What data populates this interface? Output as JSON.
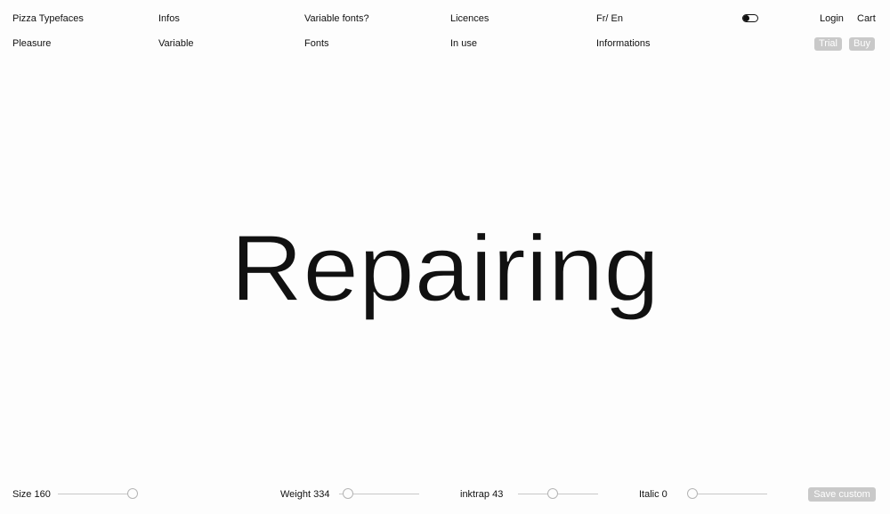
{
  "nav": {
    "row1": [
      "Pizza Typefaces",
      "Infos",
      "Variable fonts?",
      "Licences",
      "Fr/ En"
    ],
    "row2": [
      "Pleasure",
      "Variable",
      "Fonts",
      "In use",
      "Informations"
    ],
    "login": "Login",
    "cart": "Cart",
    "trial": "Trial",
    "buy": "Buy"
  },
  "specimen": {
    "text": "Repairing"
  },
  "controls": {
    "size": {
      "label": "Size 160",
      "value": 160
    },
    "weight": {
      "label": "Weight 334",
      "value": 334
    },
    "inktrap": {
      "label": "inktrap 43",
      "value": 43
    },
    "italic": {
      "label": "Italic 0",
      "value": 0
    },
    "save_label": "Save custom"
  },
  "colors": {
    "text": "#111111",
    "pill_bg": "#c9c9c9",
    "slider_track": "#c8c8c8",
    "background": "#fdfdfd"
  }
}
